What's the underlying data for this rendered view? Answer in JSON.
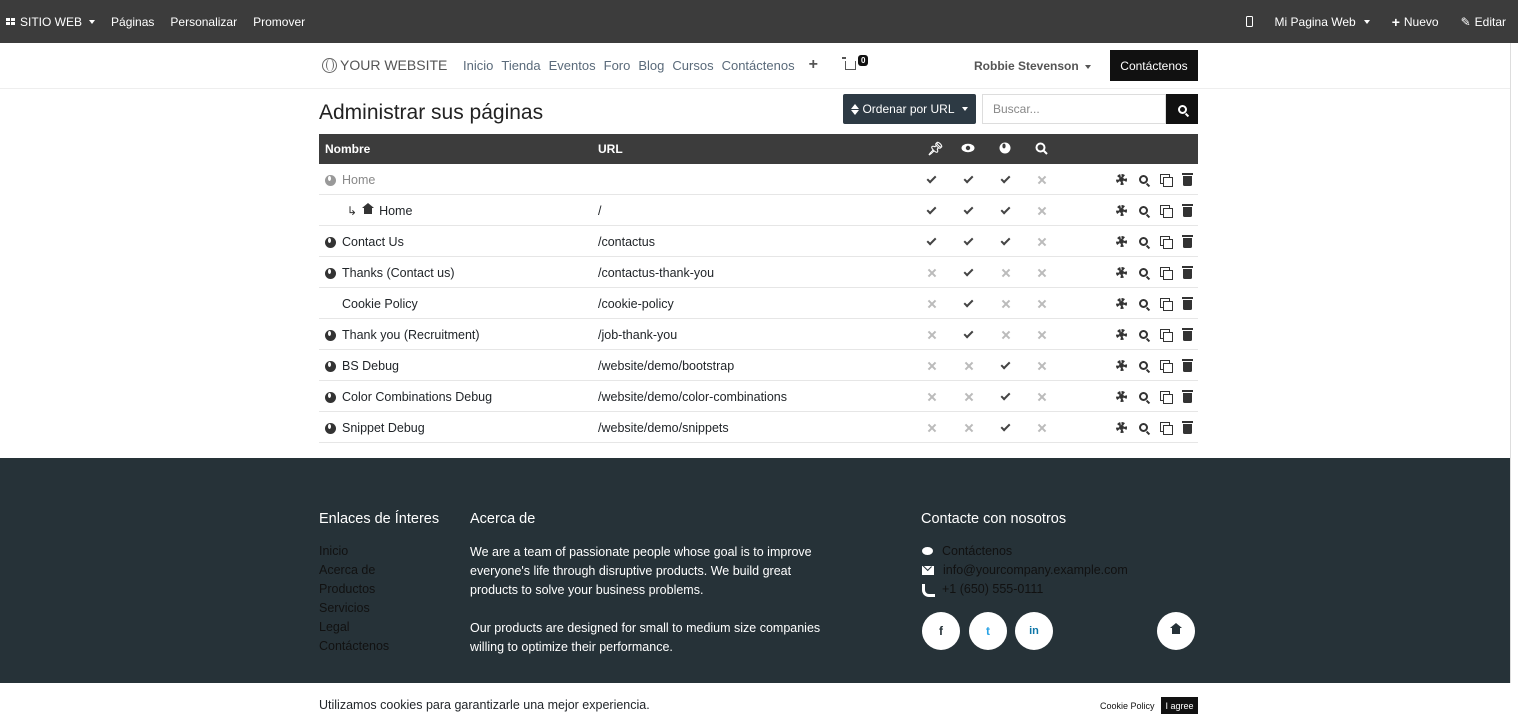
{
  "adminbar": {
    "brand": "SITIO WEB",
    "menu": [
      "Páginas",
      "Personalizar",
      "Promover"
    ],
    "site_switcher": "Mi Pagina Web",
    "new_label": "Nuevo",
    "edit_label": "Editar"
  },
  "header": {
    "logo": "YOUR WEBSITE",
    "nav": [
      "Inicio",
      "Tienda",
      "Eventos",
      "Foro",
      "Blog",
      "Cursos",
      "Contáctenos"
    ],
    "cart_count": "0",
    "user": "Robbie Stevenson",
    "cta": "Contáctenos"
  },
  "page": {
    "title": "Administrar sus páginas",
    "sort_label": "Ordenar por URL",
    "search_placeholder": "Buscar..."
  },
  "table": {
    "columns": {
      "name": "Nombre",
      "url": "URL"
    },
    "rows": [
      {
        "name": "Home",
        "url": "",
        "icon": "globe",
        "faded": true,
        "sub": false,
        "pinned": true,
        "visible": true,
        "published": true,
        "indexed": false
      },
      {
        "name": "Home",
        "url": "/",
        "icon": "home",
        "faded": false,
        "sub": true,
        "pinned": true,
        "visible": true,
        "published": true,
        "indexed": false
      },
      {
        "name": "Contact Us",
        "url": "/contactus",
        "icon": "globe",
        "faded": false,
        "sub": false,
        "pinned": true,
        "visible": true,
        "published": true,
        "indexed": false
      },
      {
        "name": "Thanks (Contact us)",
        "url": "/contactus-thank-you",
        "icon": "globe",
        "faded": false,
        "sub": false,
        "pinned": false,
        "visible": true,
        "published": false,
        "indexed": false
      },
      {
        "name": "Cookie Policy",
        "url": "/cookie-policy",
        "icon": "none",
        "faded": false,
        "sub": false,
        "pinned": false,
        "visible": true,
        "published": false,
        "indexed": false
      },
      {
        "name": "Thank you (Recruitment)",
        "url": "/job-thank-you",
        "icon": "globe",
        "faded": false,
        "sub": false,
        "pinned": false,
        "visible": true,
        "published": false,
        "indexed": false
      },
      {
        "name": "BS Debug",
        "url": "/website/demo/bootstrap",
        "icon": "globe",
        "faded": false,
        "sub": false,
        "pinned": false,
        "visible": false,
        "published": true,
        "indexed": false
      },
      {
        "name": "Color Combinations Debug",
        "url": "/website/demo/color-combinations",
        "icon": "globe",
        "faded": false,
        "sub": false,
        "pinned": false,
        "visible": false,
        "published": true,
        "indexed": false
      },
      {
        "name": "Snippet Debug",
        "url": "/website/demo/snippets",
        "icon": "globe",
        "faded": false,
        "sub": false,
        "pinned": false,
        "visible": false,
        "published": true,
        "indexed": false
      }
    ]
  },
  "footer": {
    "links_title": "Enlaces de Ínteres",
    "links": [
      "Inicio",
      "Acerca de",
      "Productos",
      "Servicios",
      "Legal",
      "Contáctenos"
    ],
    "about_title": "Acerca de",
    "about_p1": "We are a team of passionate people whose goal is to improve everyone's life through disruptive products. We build great products to solve your business problems.",
    "about_p2": "Our products are designed for small to medium size companies willing to optimize their performance.",
    "contact_title": "Contacte con nosotros",
    "contact_link": "Contáctenos",
    "email": "info@yourcompany.example.com",
    "phone": "+1 (650) 555-0111",
    "social": {
      "facebook": "f",
      "twitter": "t",
      "linkedin": "in"
    }
  },
  "cookies": {
    "text": "Utilizamos cookies para garantizarle una mejor experiencia.",
    "policy_link": "Cookie Policy",
    "agree": "I agree"
  },
  "colors": {
    "adminbar": "#3c3c3c",
    "footer": "#263238",
    "primary_button": "#111111",
    "sort_button": "#2d3a44"
  }
}
